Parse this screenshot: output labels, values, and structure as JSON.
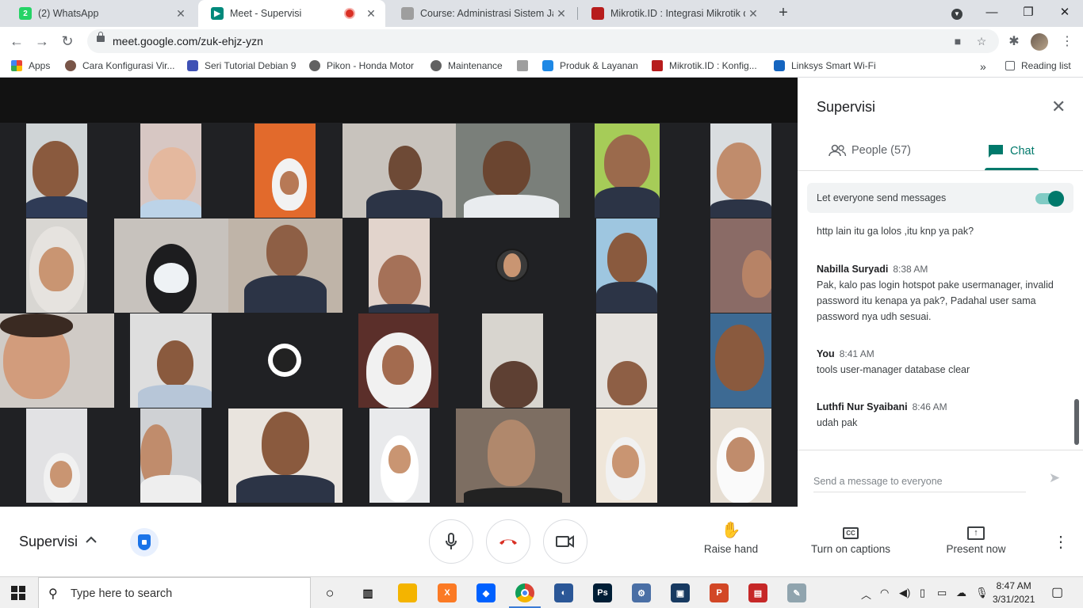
{
  "browser": {
    "tabs": [
      {
        "title": "(2) WhatsApp",
        "favicon_color": "#25d366",
        "active": false
      },
      {
        "title": "Meet - Supervisi",
        "favicon_color": "#00897b",
        "active": true,
        "recording": true
      },
      {
        "title": "Course: Administrasi Sistem Jarin",
        "favicon_color": "#9e9e9e",
        "active": false
      },
      {
        "title": "Mikrotik.ID : Integrasi Mikrotik de",
        "favicon_color": "#b71c1c",
        "active": false
      }
    ],
    "url": "meet.google.com/zuk-ehjz-yzn",
    "bookmarks": [
      {
        "label": "Apps",
        "icon_color": "#4285f4"
      },
      {
        "label": "Cara Konfigurasi Vir...",
        "icon_color": "#795548"
      },
      {
        "label": "Seri Tutorial Debian 9",
        "icon_color": "#3f51b5"
      },
      {
        "label": "Pikon - Honda Motor",
        "icon_color": "#616161"
      },
      {
        "label": "Maintenance",
        "icon_color": "#616161"
      },
      {
        "label": "",
        "icon_color": "#9e9e9e"
      },
      {
        "label": "Produk & Layanan",
        "icon_color": "#1e88e5"
      },
      {
        "label": "Mikrotik.ID : Konfig...",
        "icon_color": "#b71c1c"
      },
      {
        "label": "Linksys Smart Wi-Fi",
        "icon_color": "#1565c0"
      }
    ],
    "reading_list": "Reading list",
    "overflow": "»"
  },
  "panel": {
    "title": "Supervisi",
    "people_tab": "People (57)",
    "chat_tab": "Chat",
    "allow_label": "Let everyone send messages",
    "allow_on": true,
    "messages": [
      {
        "sender": "",
        "time": "",
        "text": "http lain itu ga lolos ,itu knp ya pak?"
      },
      {
        "sender": "Nabilla Suryadi",
        "time": "8:38 AM",
        "text": "Pak, kalo pas login hotspot pake usermanager, invalid password itu kenapa ya pak?, Padahal user sama password nya udh sesuai."
      },
      {
        "sender": "You",
        "time": "8:41 AM",
        "text": "tools user-manager database clear"
      },
      {
        "sender": "Luthfi Nur Syaibani",
        "time": "8:46 AM",
        "text": "udah pak"
      }
    ],
    "compose_placeholder": "Send a message to everyone"
  },
  "controls": {
    "meeting_name": "Supervisi",
    "raise_hand": "Raise hand",
    "captions": "Turn on captions",
    "present": "Present now"
  },
  "taskbar": {
    "search_placeholder": "Type here to search",
    "time": "8:47 AM",
    "date": "3/31/2021",
    "apps": [
      {
        "name": "file-explorer-icon",
        "color": "#f4b400",
        "glyph": ""
      },
      {
        "name": "xampp-icon",
        "color": "#fb7a24",
        "glyph": "X"
      },
      {
        "name": "dropbox-icon",
        "color": "#0061ff",
        "glyph": "◆"
      },
      {
        "name": "chrome-icon",
        "color": "#db4437",
        "glyph": ""
      },
      {
        "name": "winbox-icon",
        "color": "#2b5797",
        "glyph": "◐"
      },
      {
        "name": "photoshop-icon",
        "color": "#001e36",
        "glyph": "Ps"
      },
      {
        "name": "network-icon",
        "color": "#4a6fa5",
        "glyph": "⚙"
      },
      {
        "name": "virtualbox-icon",
        "color": "#183a61",
        "glyph": "▣"
      },
      {
        "name": "powerpoint-icon",
        "color": "#d24726",
        "glyph": "P"
      },
      {
        "name": "cisco-icon",
        "color": "#c62828",
        "glyph": "▤"
      },
      {
        "name": "paint-icon",
        "color": "#90a4ae",
        "glyph": "✎"
      }
    ]
  }
}
